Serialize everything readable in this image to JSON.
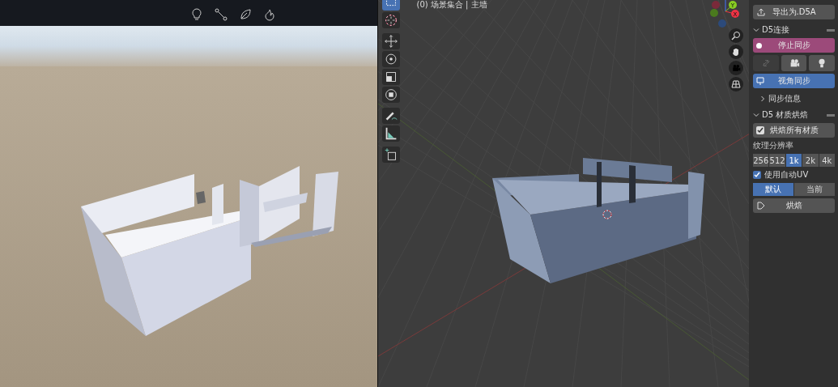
{
  "viewport": {
    "header": "(0) 场景集合 | 主墙",
    "tools": [
      {
        "kind": "select",
        "selected": true
      },
      {
        "kind": "cursor",
        "selected": false
      },
      {
        "kind": "move",
        "selected": false
      },
      {
        "kind": "rotate",
        "selected": false
      },
      {
        "kind": "scale",
        "selected": false
      },
      {
        "kind": "transform",
        "selected": false
      },
      {
        "kind": "annotate",
        "selected": false
      },
      {
        "kind": "measure",
        "selected": false
      },
      {
        "kind": "add-cube",
        "selected": false
      }
    ],
    "gizmo": {
      "y_label": "Y",
      "x_label": "X"
    }
  },
  "sidebar": {
    "export_button": "导出为.D5A",
    "d5_connection": {
      "title": "D5连接",
      "expanded": true,
      "stop_sync": "停止同步",
      "icon_buttons": [
        {
          "kind": "sync",
          "disabled": true
        },
        {
          "kind": "camera",
          "disabled": false
        },
        {
          "kind": "light",
          "disabled": false
        }
      ],
      "view_sync": "视角同步",
      "sync_info": {
        "title": "同步信息",
        "expanded": false
      }
    },
    "material_bake": {
      "title": "D5 材质烘焙",
      "expanded": true,
      "bake_all": {
        "label": "烘焙所有材质",
        "checked": true
      },
      "resolution_label": "纹理分辨率",
      "resolutions": [
        {
          "label": "256",
          "selected": false
        },
        {
          "label": "512",
          "selected": false
        },
        {
          "label": "1k",
          "selected": true
        },
        {
          "label": "2k",
          "selected": false
        },
        {
          "label": "4k",
          "selected": false
        }
      ],
      "auto_uv": {
        "label": "使用自动UV",
        "checked": true
      },
      "modes": [
        {
          "label": "默认",
          "selected": true
        },
        {
          "label": "当前",
          "selected": false
        }
      ],
      "bake_button": "烘焙"
    }
  }
}
